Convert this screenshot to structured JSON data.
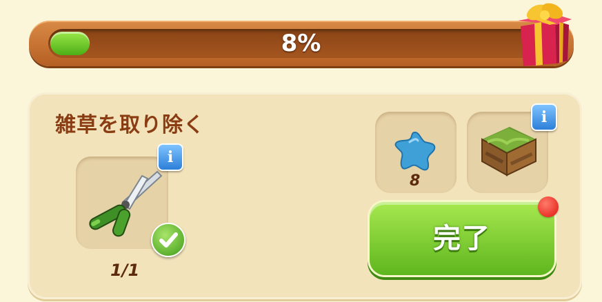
{
  "progress": {
    "percent_label": "8%",
    "value": 0.08,
    "reward_icon": "gift-box-icon"
  },
  "task": {
    "title": "雑草を取り除く",
    "tool": {
      "icon": "pruning-shears-icon",
      "count_label": "1/1",
      "completed": true,
      "info_label": "i"
    },
    "rewards": [
      {
        "icon": "blue-star-icon",
        "amount_label": "8"
      },
      {
        "icon": "grass-crate-icon",
        "info_label": "i"
      }
    ],
    "complete_button_label": "完了"
  },
  "colors": {
    "progress_fill": "#6cc42a",
    "panel_bg": "#f3e3bb",
    "button_green": "#7ccc2e",
    "notification_red": "#e8221a"
  }
}
